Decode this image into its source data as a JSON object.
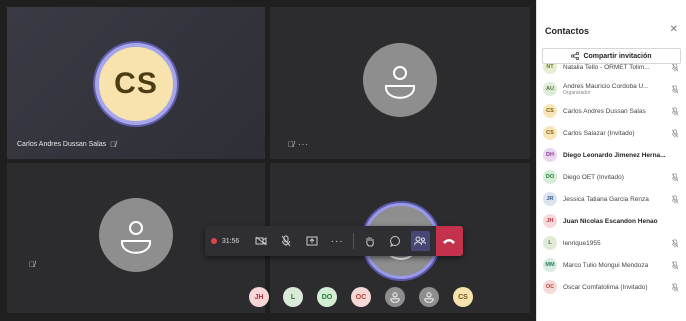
{
  "tiles": [
    {
      "initials": "CS",
      "name": "Carlos Andres Dussan Salas"
    }
  ],
  "controls": {
    "timer": "31:56"
  },
  "bottom_avatars": [
    {
      "initials": "JH",
      "bg": "#f6d6d6",
      "fg": "#b2303a"
    },
    {
      "initials": "L",
      "bg": "#d9ead8",
      "fg": "#3c6b37"
    },
    {
      "initials": "DO",
      "bg": "#d4eed6",
      "fg": "#237b2f"
    },
    {
      "initials": "OC",
      "bg": "#f6d8d6",
      "fg": "#b1413b"
    },
    {
      "initials": "",
      "bg": "#8e8e8e",
      "fg": "#ffffff"
    },
    {
      "initials": "",
      "bg": "#8e8e8e",
      "fg": "#ffffff"
    },
    {
      "initials": "CS",
      "bg": "#f8e2ad",
      "fg": "#6b5516"
    }
  ],
  "sidebar": {
    "title": "Contactos",
    "share_label": "Compartir invitación",
    "people": [
      {
        "initials": "NT",
        "name": "Natalia Tello - ORMET Tolim...",
        "sub": "",
        "bg": "#e6edd2",
        "fg": "#6b7d2c",
        "bold": false,
        "mic": true
      },
      {
        "initials": "AU",
        "name": "Andres Mauricio Cordoba U...",
        "sub": "Organizador",
        "bg": "#e0ecd8",
        "fg": "#4c7a3a",
        "bold": false,
        "mic": true
      },
      {
        "initials": "CS",
        "name": "Carlos Andres Dussan Salas",
        "sub": "",
        "bg": "#f8e6b8",
        "fg": "#7a5b12",
        "bold": false,
        "mic": true
      },
      {
        "initials": "CS",
        "name": "Carlos Salazar (Invitado)",
        "sub": "",
        "bg": "#f8e6b8",
        "fg": "#7a5b12",
        "bold": false,
        "mic": true
      },
      {
        "initials": "DH",
        "name": "Diego Leonardo Jimenez Herna...",
        "sub": "",
        "bg": "#ead8ee",
        "fg": "#8a3a8e",
        "bold": true,
        "mic": false
      },
      {
        "initials": "DO",
        "name": "Diego OET (Invitado)",
        "sub": "",
        "bg": "#d6eed8",
        "fg": "#2b7a34",
        "bold": false,
        "mic": true
      },
      {
        "initials": "JR",
        "name": "Jessica Tatiana Garcia Renza",
        "sub": "",
        "bg": "#dbe4ee",
        "fg": "#3a5a8a",
        "bold": false,
        "mic": true
      },
      {
        "initials": "JH",
        "name": "Juan Nicolas Escandon Henao",
        "sub": "",
        "bg": "#f6dada",
        "fg": "#b2303a",
        "bold": true,
        "mic": false
      },
      {
        "initials": "L",
        "name": "lenrique1955",
        "sub": "",
        "bg": "#e2ead8",
        "fg": "#4c6b37",
        "bold": false,
        "mic": true
      },
      {
        "initials": "MM",
        "name": "Marco Tulio Mongui Mendoza",
        "sub": "",
        "bg": "#d8ece2",
        "fg": "#2f7a58",
        "bold": false,
        "mic": true
      },
      {
        "initials": "OC",
        "name": "Oscar Comfatolima (Invitado)",
        "sub": "",
        "bg": "#f6dad8",
        "fg": "#b1413b",
        "bold": false,
        "mic": true
      }
    ]
  }
}
